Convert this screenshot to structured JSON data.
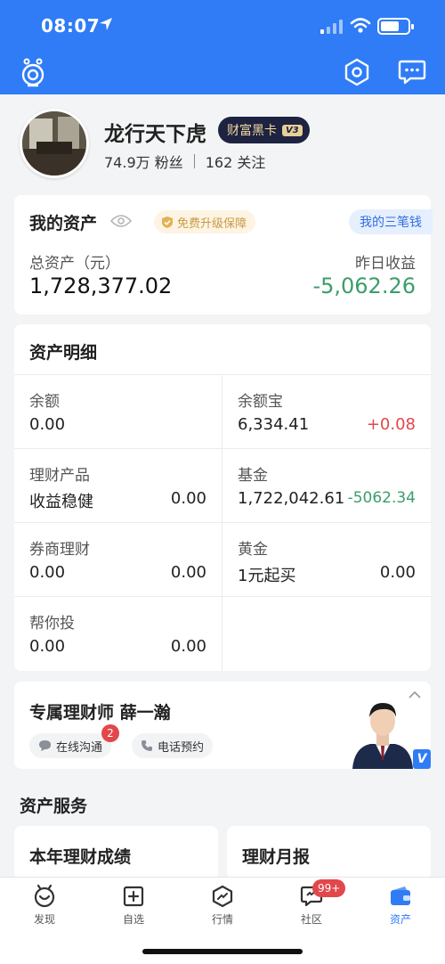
{
  "status_bar": {
    "time": "08:07"
  },
  "user": {
    "name": "龙行天下虎",
    "badge": "财富黑卡",
    "badge_level": "V3",
    "followers": "74.9万 粉丝",
    "following": "162 关注"
  },
  "assets": {
    "title": "我的资产",
    "protect_label": "免费升级保障",
    "three_money_link": "我的三笔钱",
    "total_label": "总资产（元）",
    "total_value": "1,728,377.02",
    "yesterday_label": "昨日收益",
    "yesterday_value": "-5,062.26"
  },
  "detail": {
    "title": "资产明细",
    "cells": [
      {
        "label": "余额",
        "value": "0.00",
        "sub": "",
        "change": ""
      },
      {
        "label": "余额宝",
        "value": "6,334.41",
        "sub": "",
        "change": "+0.08"
      },
      {
        "label": "理财产品",
        "value": "收益稳健",
        "sub": "0.00",
        "change": ""
      },
      {
        "label": "基金",
        "value": "1,722,042.61",
        "sub": "",
        "change": "-5062.34"
      },
      {
        "label": "券商理财",
        "value": "0.00",
        "sub": "0.00",
        "change": ""
      },
      {
        "label": "黄金",
        "value": "1元起买",
        "sub": "0.00",
        "change": ""
      },
      {
        "label": "帮你投",
        "value": "0.00",
        "sub": "0.00",
        "change": ""
      }
    ]
  },
  "advisor": {
    "title": "专属理财师 薛一瀚",
    "chat_label": "在线沟通",
    "chat_badge": "2",
    "call_label": "电话预约",
    "verified_mark": "V"
  },
  "services": {
    "title": "资产服务",
    "cards": [
      {
        "title": "本年理财成绩"
      },
      {
        "title": "理财月报"
      }
    ]
  },
  "tabbar": {
    "tabs": [
      {
        "label": "发现",
        "icon": "discover-icon"
      },
      {
        "label": "自选",
        "icon": "watchlist-icon"
      },
      {
        "label": "行情",
        "icon": "market-icon"
      },
      {
        "label": "社区",
        "icon": "community-icon",
        "badge": "99+"
      },
      {
        "label": "资产",
        "icon": "assets-icon"
      }
    ]
  },
  "colors": {
    "brand_blue": "#2f7cf6",
    "gain_red": "#e2474b",
    "loss_green": "#3b9e6a"
  }
}
